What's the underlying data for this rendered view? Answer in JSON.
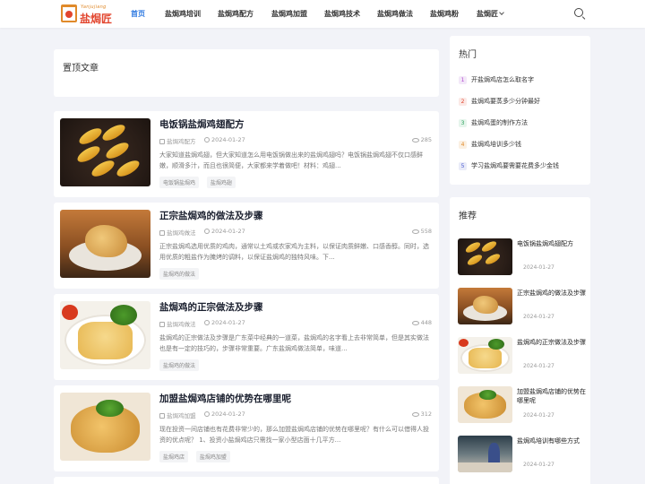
{
  "brand": {
    "logo_sub": "Yanjujiang",
    "logo_text": "盐焗匠"
  },
  "nav": {
    "items": [
      {
        "label": "首页",
        "active": true
      },
      {
        "label": "盐焗鸡培训"
      },
      {
        "label": "盐焗鸡配方"
      },
      {
        "label": "盐焗鸡加盟"
      },
      {
        "label": "盐焗鸡技术"
      },
      {
        "label": "盐焗鸡做法"
      },
      {
        "label": "盐焗鸡粉"
      },
      {
        "label": "盐焗匠",
        "dropdown": true
      }
    ],
    "search_icon": "search-icon"
  },
  "pinned": {
    "title": "置顶文章"
  },
  "articles": [
    {
      "title": "电饭锅盐焗鸡翅配方",
      "category": "盐焗鸡配方",
      "date": "2024-01-27",
      "views": "285",
      "excerpt": "大家知道盐焗鸡翅，但大家知道怎么用电饭锅做出来的盐焗鸡翅吗？电饭锅盐焗鸡翅不仅口感鲜嫩，顺滑多汁，而且也很简便，大家都来学着做吧！材料：鸡翅...",
      "tags": [
        "电饭锅盐焗鸡",
        "盐焗鸡翅"
      ]
    },
    {
      "title": "正宗盐焗鸡的做法及步骤",
      "category": "盐焗鸡做法",
      "date": "2024-01-27",
      "views": "558",
      "excerpt": "正宗盐焗鸡选用优质的鸡肉，通常以土鸡或农家鸡为主料，以保证肉质鲜嫩、口感香醇。同时，选用优质的粗盐作为腌烤的调料，以保证盐焗鸡的独特风味。下...",
      "tags": [
        "盐焗鸡的做法"
      ]
    },
    {
      "title": "盐焗鸡的正宗做法及步骤",
      "category": "盐焗鸡做法",
      "date": "2024-01-27",
      "views": "448",
      "excerpt": "盐焗鸡的正宗做法及步骤是广东菜中经典的一道菜，盐焗鸡的名字看上去非常简单，但是其实做法也是有一定的技巧的，步骤非常重要。广东盐焗鸡做法简单，味道...",
      "tags": [
        "盐焗鸡的做法"
      ]
    },
    {
      "title": "加盟盐焗鸡店铺的优势在哪里呢",
      "category": "盐焗鸡加盟",
      "date": "2024-01-27",
      "views": "312",
      "excerpt": "现在投资一间店铺也有花费非常少的，那么加盟盐焗鸡店铺的优势在哪里呢？有什么可以借得人投资的优点呢？ 1、投资小盐焗鸡店只需找一家小型店面十几平方...",
      "tags": [
        "盐焗鸡店",
        "盐焗鸡加盟"
      ]
    }
  ],
  "sidebar": {
    "hot_title": "热门",
    "hot": [
      {
        "rank": "1",
        "title": "开盐焗鸡店怎么取名字",
        "color": "#b04ad0"
      },
      {
        "rank": "2",
        "title": "盐焗鸡要蒸多少分钟最好",
        "color": "#e2452e"
      },
      {
        "rank": "3",
        "title": "盐焗鸡蛋的制作方法",
        "color": "#2aa05a"
      },
      {
        "rank": "4",
        "title": "盐焗鸡培训多少钱",
        "color": "#e08a2a"
      },
      {
        "rank": "5",
        "title": "学习盐焗鸡要需要花费多少金钱",
        "color": "#4a5ad0"
      }
    ],
    "rec_title": "推荐",
    "recommended": [
      {
        "title": "电饭锅盐焗鸡翅配方",
        "date": "2024-01-27"
      },
      {
        "title": "正宗盐焗鸡的做法及步骤",
        "date": "2024-01-27"
      },
      {
        "title": "盐焗鸡的正宗做法及步骤",
        "date": "2024-01-27"
      },
      {
        "title": "加盟盐焗鸡店铺的优势在哪里呢",
        "date": "2024-01-27"
      },
      {
        "title": "盐焗鸡培训有哪些方式",
        "date": "2024-01-27"
      }
    ]
  },
  "colors": {
    "accent": "#2f7ae0",
    "brand": "#e2452e"
  }
}
